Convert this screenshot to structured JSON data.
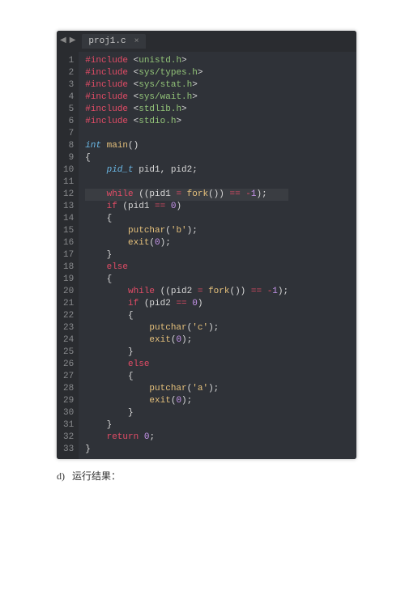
{
  "tabbar": {
    "prev_arrow": "◀",
    "next_arrow": "▶",
    "tab_label": "proj1.c",
    "tab_close": "×"
  },
  "lines": [
    [
      [
        "kw-red",
        "#"
      ],
      [
        "ctrl",
        "include"
      ],
      [
        "punct",
        " <"
      ],
      [
        "str",
        "unistd.h"
      ],
      [
        "punct",
        ">"
      ]
    ],
    [
      [
        "kw-red",
        "#"
      ],
      [
        "ctrl",
        "include"
      ],
      [
        "punct",
        " <"
      ],
      [
        "str",
        "sys/types.h"
      ],
      [
        "punct",
        ">"
      ]
    ],
    [
      [
        "kw-red",
        "#"
      ],
      [
        "ctrl",
        "include"
      ],
      [
        "punct",
        " <"
      ],
      [
        "str",
        "sys/stat.h"
      ],
      [
        "punct",
        ">"
      ]
    ],
    [
      [
        "kw-red",
        "#"
      ],
      [
        "ctrl",
        "include"
      ],
      [
        "punct",
        " <"
      ],
      [
        "str",
        "sys/wait.h"
      ],
      [
        "punct",
        ">"
      ]
    ],
    [
      [
        "kw-red",
        "#"
      ],
      [
        "ctrl",
        "include"
      ],
      [
        "punct",
        " <"
      ],
      [
        "str",
        "stdlib.h"
      ],
      [
        "punct",
        ">"
      ]
    ],
    [
      [
        "kw-red",
        "#"
      ],
      [
        "ctrl",
        "include"
      ],
      [
        "punct",
        " <"
      ],
      [
        "str",
        "stdio.h"
      ],
      [
        "punct",
        ">"
      ]
    ],
    [
      [
        "punct",
        ""
      ]
    ],
    [
      [
        "type",
        "int"
      ],
      [
        "punct",
        " "
      ],
      [
        "func",
        "main"
      ],
      [
        "punct",
        "()"
      ]
    ],
    [
      [
        "punct",
        "{"
      ]
    ],
    [
      [
        "punct",
        "    "
      ],
      [
        "type",
        "pid_t"
      ],
      [
        "punct",
        " pid1, pid2;"
      ]
    ],
    [
      [
        "punct",
        ""
      ]
    ],
    [
      [
        "punct",
        "    "
      ],
      [
        "ctrl",
        "while"
      ],
      [
        "punct",
        " ((pid1 "
      ],
      [
        "op",
        "="
      ],
      [
        "punct",
        " "
      ],
      [
        "func",
        "fork"
      ],
      [
        "punct",
        "()) "
      ],
      [
        "op",
        "=="
      ],
      [
        "punct",
        " "
      ],
      [
        "op",
        "-"
      ],
      [
        "num",
        "1"
      ],
      [
        "punct",
        ");"
      ]
    ],
    [
      [
        "punct",
        "    "
      ],
      [
        "ctrl",
        "if"
      ],
      [
        "punct",
        " (pid1 "
      ],
      [
        "op",
        "=="
      ],
      [
        "punct",
        " "
      ],
      [
        "num",
        "0"
      ],
      [
        "punct",
        ")"
      ]
    ],
    [
      [
        "punct",
        "    {"
      ]
    ],
    [
      [
        "punct",
        "        "
      ],
      [
        "func",
        "putchar"
      ],
      [
        "punct",
        "("
      ],
      [
        "charlit",
        "'b'"
      ],
      [
        "punct",
        ");"
      ]
    ],
    [
      [
        "punct",
        "        "
      ],
      [
        "func",
        "exit"
      ],
      [
        "punct",
        "("
      ],
      [
        "num",
        "0"
      ],
      [
        "punct",
        ");"
      ]
    ],
    [
      [
        "punct",
        "    }"
      ]
    ],
    [
      [
        "punct",
        "    "
      ],
      [
        "ctrl",
        "else"
      ]
    ],
    [
      [
        "punct",
        "    {"
      ]
    ],
    [
      [
        "punct",
        "        "
      ],
      [
        "ctrl",
        "while"
      ],
      [
        "punct",
        " ((pid2 "
      ],
      [
        "op",
        "="
      ],
      [
        "punct",
        " "
      ],
      [
        "func",
        "fork"
      ],
      [
        "punct",
        "()) "
      ],
      [
        "op",
        "=="
      ],
      [
        "punct",
        " "
      ],
      [
        "op",
        "-"
      ],
      [
        "num",
        "1"
      ],
      [
        "punct",
        ");"
      ]
    ],
    [
      [
        "punct",
        "        "
      ],
      [
        "ctrl",
        "if"
      ],
      [
        "punct",
        " (pid2 "
      ],
      [
        "op",
        "=="
      ],
      [
        "punct",
        " "
      ],
      [
        "num",
        "0"
      ],
      [
        "punct",
        ")"
      ]
    ],
    [
      [
        "punct",
        "        {"
      ]
    ],
    [
      [
        "punct",
        "            "
      ],
      [
        "func",
        "putchar"
      ],
      [
        "punct",
        "("
      ],
      [
        "charlit",
        "'c'"
      ],
      [
        "punct",
        ");"
      ]
    ],
    [
      [
        "punct",
        "            "
      ],
      [
        "func",
        "exit"
      ],
      [
        "punct",
        "("
      ],
      [
        "num",
        "0"
      ],
      [
        "punct",
        ");"
      ]
    ],
    [
      [
        "punct",
        "        }"
      ]
    ],
    [
      [
        "punct",
        "        "
      ],
      [
        "ctrl",
        "else"
      ]
    ],
    [
      [
        "punct",
        "        {"
      ]
    ],
    [
      [
        "punct",
        "            "
      ],
      [
        "func",
        "putchar"
      ],
      [
        "punct",
        "("
      ],
      [
        "charlit",
        "'a'"
      ],
      [
        "punct",
        ");"
      ]
    ],
    [
      [
        "punct",
        "            "
      ],
      [
        "func",
        "exit"
      ],
      [
        "punct",
        "("
      ],
      [
        "num",
        "0"
      ],
      [
        "punct",
        ");"
      ]
    ],
    [
      [
        "punct",
        "        }"
      ]
    ],
    [
      [
        "punct",
        "    }"
      ]
    ],
    [
      [
        "punct",
        "    "
      ],
      [
        "ctrl",
        "return"
      ],
      [
        "punct",
        " "
      ],
      [
        "num",
        "0"
      ],
      [
        "punct",
        ";"
      ]
    ],
    [
      [
        "punct",
        "}"
      ]
    ]
  ],
  "highlight_line": 12,
  "line_count": 33,
  "footer": {
    "item_label": "d)",
    "item_text": "运行结果："
  }
}
